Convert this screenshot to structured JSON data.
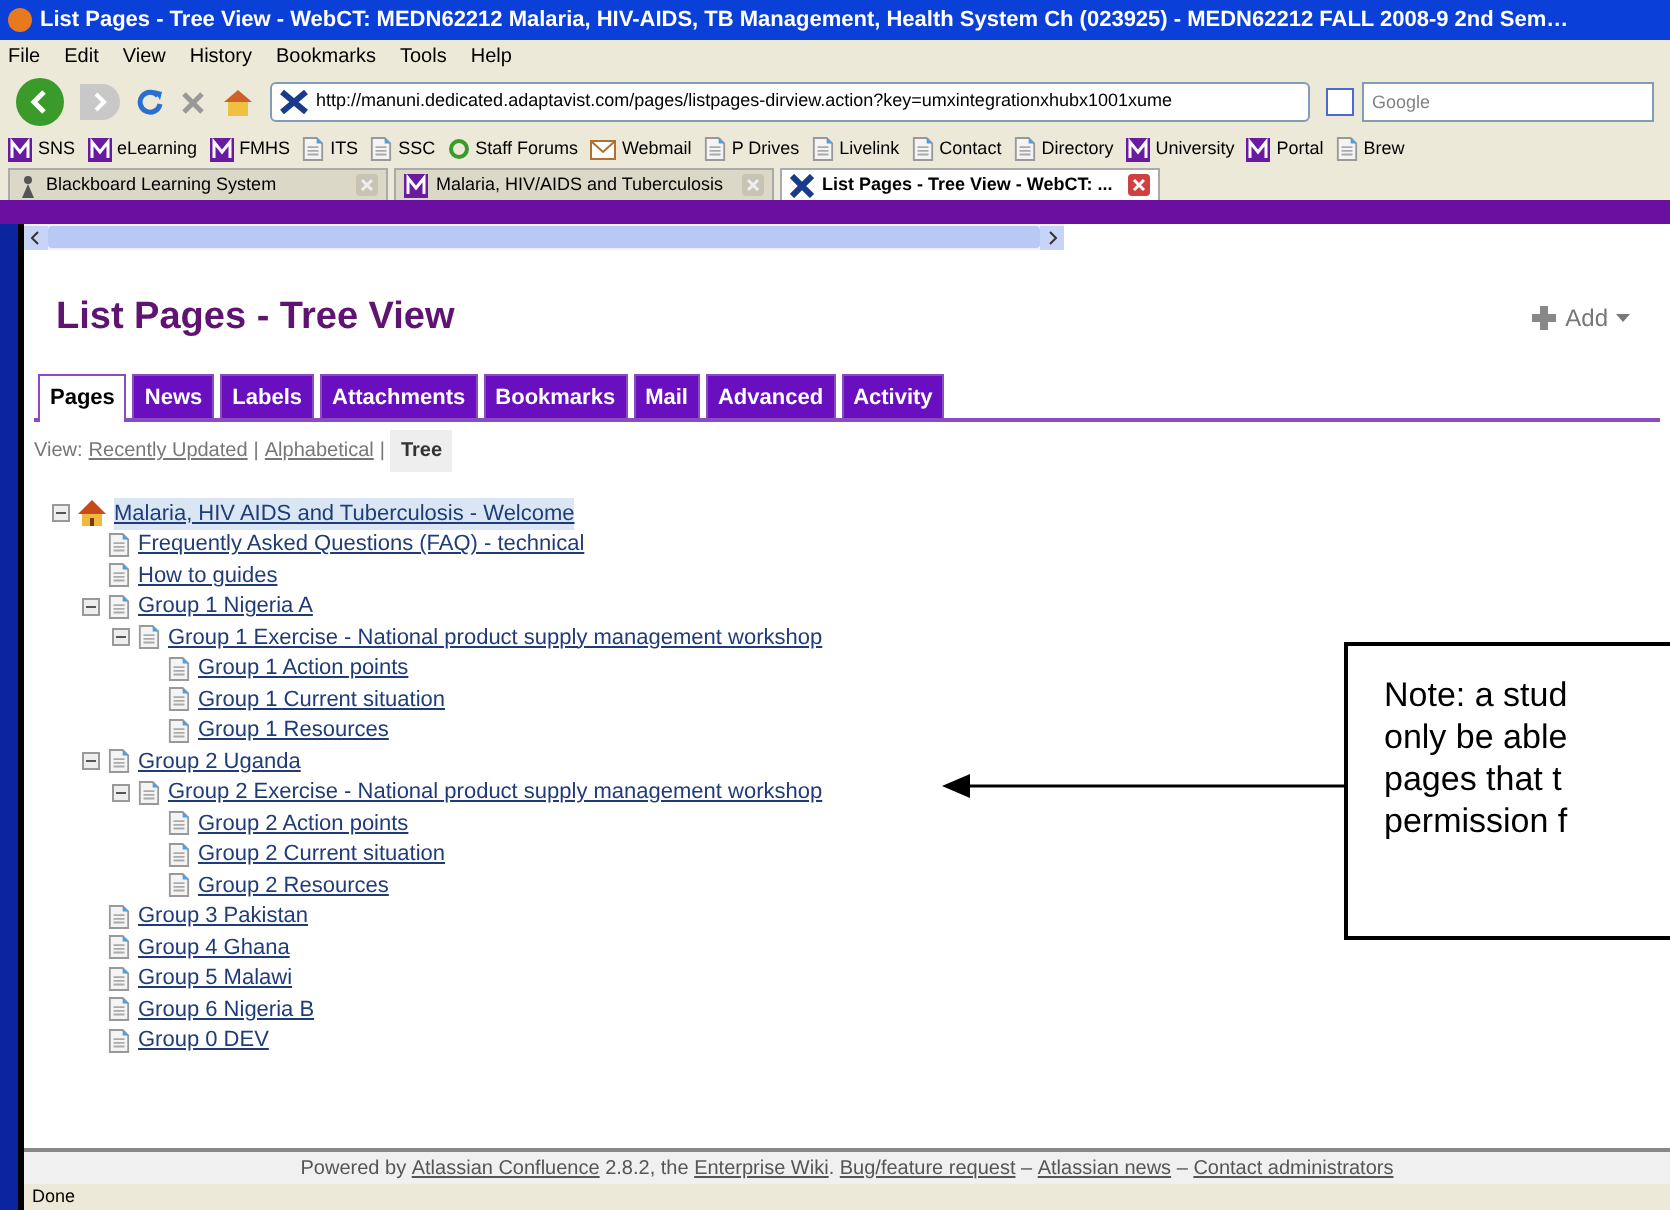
{
  "window": {
    "title": "List Pages - Tree View - WebCT: MEDN62212 Malaria, HIV-AIDS, TB Management, Health System Ch (023925) - MEDN62212 FALL 2008-9 2nd Sem…"
  },
  "menu": [
    "File",
    "Edit",
    "View",
    "History",
    "Bookmarks",
    "Tools",
    "Help"
  ],
  "address_bar": {
    "value": "http://manuni.dedicated.adaptavist.com/pages/listpages-dirview.action?key=umxintegrationxhubx1001xume"
  },
  "search": {
    "placeholder": "Google"
  },
  "bookmarks": [
    {
      "kind": "m",
      "label": "SNS"
    },
    {
      "kind": "m",
      "label": "eLearning"
    },
    {
      "kind": "m",
      "label": "FMHS"
    },
    {
      "kind": "page",
      "label": "ITS"
    },
    {
      "kind": "page",
      "label": "SSC"
    },
    {
      "kind": "forum",
      "label": "Staff Forums"
    },
    {
      "kind": "mail",
      "label": "Webmail"
    },
    {
      "kind": "page",
      "label": "P Drives"
    },
    {
      "kind": "page",
      "label": "Livelink"
    },
    {
      "kind": "page",
      "label": "Contact"
    },
    {
      "kind": "page",
      "label": "Directory"
    },
    {
      "kind": "m",
      "label": "University"
    },
    {
      "kind": "m",
      "label": "Portal"
    },
    {
      "kind": "page",
      "label": "Brew"
    }
  ],
  "browser_tabs": [
    {
      "kind": "figure",
      "label": "Blackboard Learning System",
      "selected": false
    },
    {
      "kind": "m",
      "label": "Malaria, HIV/AIDS and Tuberculosis",
      "selected": false
    },
    {
      "kind": "x",
      "label": "List Pages - Tree View - WebCT: ...",
      "selected": true
    }
  ],
  "page": {
    "title": "List Pages - Tree View",
    "add_button": "Add",
    "tabs": [
      {
        "label": "Pages",
        "selected": true
      },
      {
        "label": "News",
        "selected": false
      },
      {
        "label": "Labels",
        "selected": false
      },
      {
        "label": "Attachments",
        "selected": false
      },
      {
        "label": "Bookmarks",
        "selected": false
      },
      {
        "label": "Mail",
        "selected": false
      },
      {
        "label": "Advanced",
        "selected": false
      },
      {
        "label": "Activity",
        "selected": false
      }
    ],
    "view_label": "View:",
    "view_separator": "|",
    "view_options": [
      {
        "label": "Recently Updated",
        "selected": false
      },
      {
        "label": "Alphabetical",
        "selected": false
      },
      {
        "label": "Tree",
        "selected": true
      }
    ],
    "tree": [
      {
        "label": "Malaria, HIV AIDS and Tuberculosis - Welcome",
        "kind": "home",
        "selected": true,
        "expanded": true,
        "children": [
          {
            "label": "Frequently Asked Questions (FAQ) - technical",
            "kind": "page",
            "selected": false
          },
          {
            "label": "How to guides",
            "kind": "page",
            "selected": false
          },
          {
            "label": "Group 1 Nigeria A",
            "kind": "page",
            "selected": false,
            "expanded": true,
            "children": [
              {
                "label": "Group 1 Exercise - National product supply management workshop",
                "kind": "page",
                "selected": false,
                "expanded": true,
                "children": [
                  {
                    "label": "Group 1 Action points",
                    "kind": "page",
                    "selected": false
                  },
                  {
                    "label": "Group 1 Current situation",
                    "kind": "page",
                    "selected": false
                  },
                  {
                    "label": "Group 1 Resources",
                    "kind": "page",
                    "selected": false
                  }
                ]
              }
            ]
          },
          {
            "label": "Group 2 Uganda",
            "kind": "page",
            "selected": false,
            "expanded": true,
            "children": [
              {
                "label": "Group 2 Exercise - National product supply management workshop",
                "kind": "page",
                "selected": false,
                "expanded": true,
                "children": [
                  {
                    "label": "Group 2 Action points",
                    "kind": "page",
                    "selected": false
                  },
                  {
                    "label": "Group 2 Current situation",
                    "kind": "page",
                    "selected": false
                  },
                  {
                    "label": "Group 2 Resources",
                    "kind": "page",
                    "selected": false
                  }
                ]
              }
            ]
          },
          {
            "label": "Group 3 Pakistan",
            "kind": "page",
            "selected": false
          },
          {
            "label": "Group 4 Ghana",
            "kind": "page",
            "selected": false
          },
          {
            "label": "Group 5 Malawi",
            "kind": "page",
            "selected": false
          },
          {
            "label": "Group 6 Nigeria B",
            "kind": "page",
            "selected": false
          },
          {
            "label": "Group 0 DEV",
            "kind": "page",
            "selected": false
          }
        ]
      }
    ],
    "footer": [
      {
        "kind": "text",
        "text": "Powered by "
      },
      {
        "kind": "link",
        "text": "Atlassian Confluence"
      },
      {
        "kind": "text",
        "text": " 2.8.2, the "
      },
      {
        "kind": "link",
        "text": "Enterprise Wiki"
      },
      {
        "kind": "text",
        "text": ". "
      },
      {
        "kind": "link",
        "text": "Bug/feature request"
      },
      {
        "kind": "text",
        "text": " – "
      },
      {
        "kind": "link",
        "text": "Atlassian news"
      },
      {
        "kind": "text",
        "text": " – "
      },
      {
        "kind": "link",
        "text": "Contact administrators"
      }
    ]
  },
  "note": {
    "lines": [
      "Note: a stud",
      "only be able",
      "pages that t",
      "permission f"
    ]
  },
  "status_bar": "Done"
}
